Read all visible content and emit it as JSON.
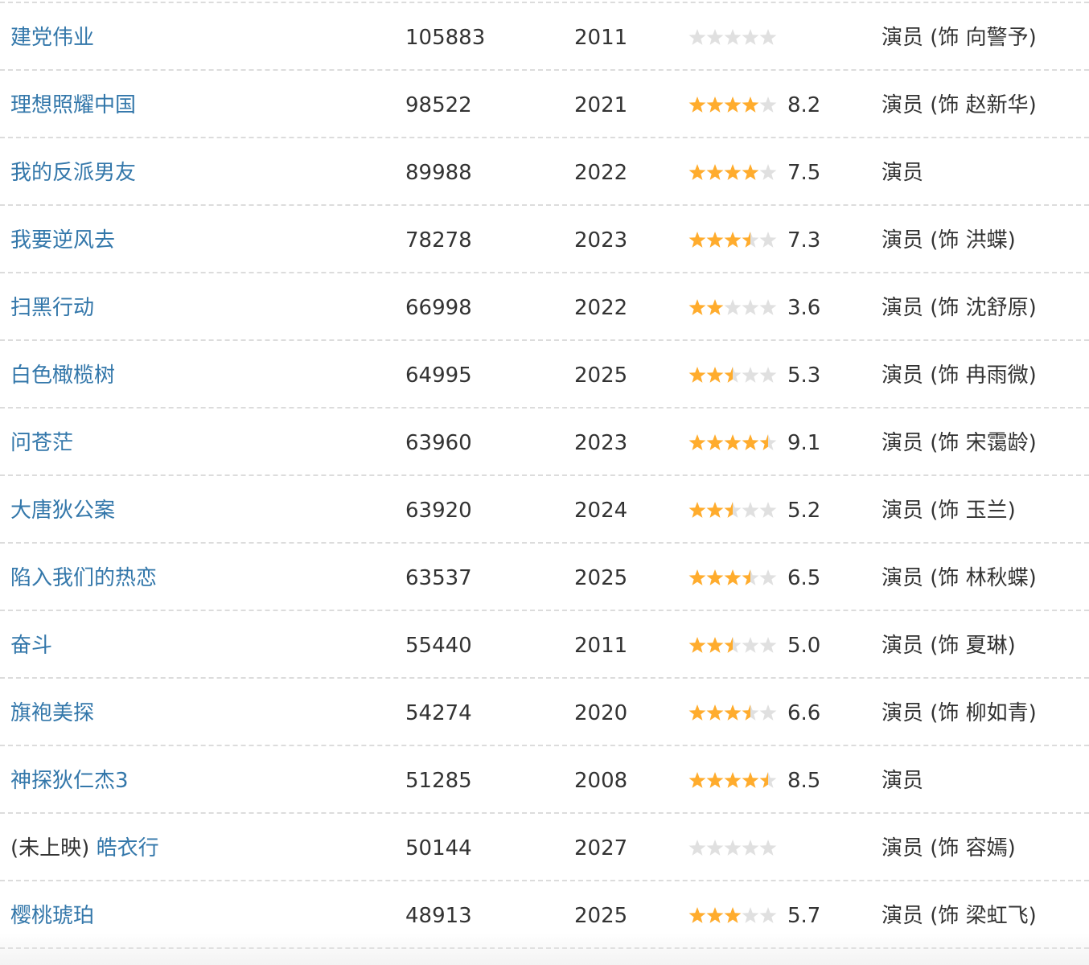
{
  "colors": {
    "link": "#3377aa",
    "text": "#333333",
    "star_on": "#ffac2d",
    "star_off": "#e0e0e0",
    "divider": "#dcdcdc"
  },
  "rows": [
    {
      "prefix": "",
      "title": "建党伟业",
      "votes": "105883",
      "year": "2011",
      "stars": 0,
      "score": "",
      "role": "演员 (饰 向警予)"
    },
    {
      "prefix": "",
      "title": "理想照耀中国",
      "votes": "98522",
      "year": "2021",
      "stars": 4,
      "score": "8.2",
      "role": "演员 (饰 赵新华)"
    },
    {
      "prefix": "",
      "title": "我的反派男友",
      "votes": "89988",
      "year": "2022",
      "stars": 4,
      "score": "7.5",
      "role": "演员"
    },
    {
      "prefix": "",
      "title": "我要逆风去",
      "votes": "78278",
      "year": "2023",
      "stars": 3.5,
      "score": "7.3",
      "role": "演员 (饰 洪蝶)"
    },
    {
      "prefix": "",
      "title": "扫黑行动",
      "votes": "66998",
      "year": "2022",
      "stars": 2,
      "score": "3.6",
      "role": "演员 (饰 沈舒原)"
    },
    {
      "prefix": "",
      "title": "白色橄榄树",
      "votes": "64995",
      "year": "2025",
      "stars": 2.5,
      "score": "5.3",
      "role": "演员 (饰 冉雨微)"
    },
    {
      "prefix": "",
      "title": "问苍茫",
      "votes": "63960",
      "year": "2023",
      "stars": 4.5,
      "score": "9.1",
      "role": "演员 (饰 宋霭龄)"
    },
    {
      "prefix": "",
      "title": "大唐狄公案",
      "votes": "63920",
      "year": "2024",
      "stars": 2.5,
      "score": "5.2",
      "role": "演员 (饰 玉兰)"
    },
    {
      "prefix": "",
      "title": "陷入我们的热恋",
      "votes": "63537",
      "year": "2025",
      "stars": 3.5,
      "score": "6.5",
      "role": "演员 (饰 林秋蝶)"
    },
    {
      "prefix": "",
      "title": "奋斗",
      "votes": "55440",
      "year": "2011",
      "stars": 2.5,
      "score": "5.0",
      "role": "演员 (饰 夏琳)"
    },
    {
      "prefix": "",
      "title": "旗袍美探",
      "votes": "54274",
      "year": "2020",
      "stars": 3.5,
      "score": "6.6",
      "role": "演员 (饰 柳如青)"
    },
    {
      "prefix": "",
      "title": "神探狄仁杰3",
      "votes": "51285",
      "year": "2008",
      "stars": 4.5,
      "score": "8.5",
      "role": "演员"
    },
    {
      "prefix": "(未上映)",
      "title": "皓衣行",
      "votes": "50144",
      "year": "2027",
      "stars": 0,
      "score": "",
      "role": "演员 (饰 容嫣)"
    },
    {
      "prefix": "",
      "title": "樱桃琥珀",
      "votes": "48913",
      "year": "2025",
      "stars": 3,
      "score": "5.7",
      "role": "演员 (饰 梁虹飞)"
    }
  ]
}
